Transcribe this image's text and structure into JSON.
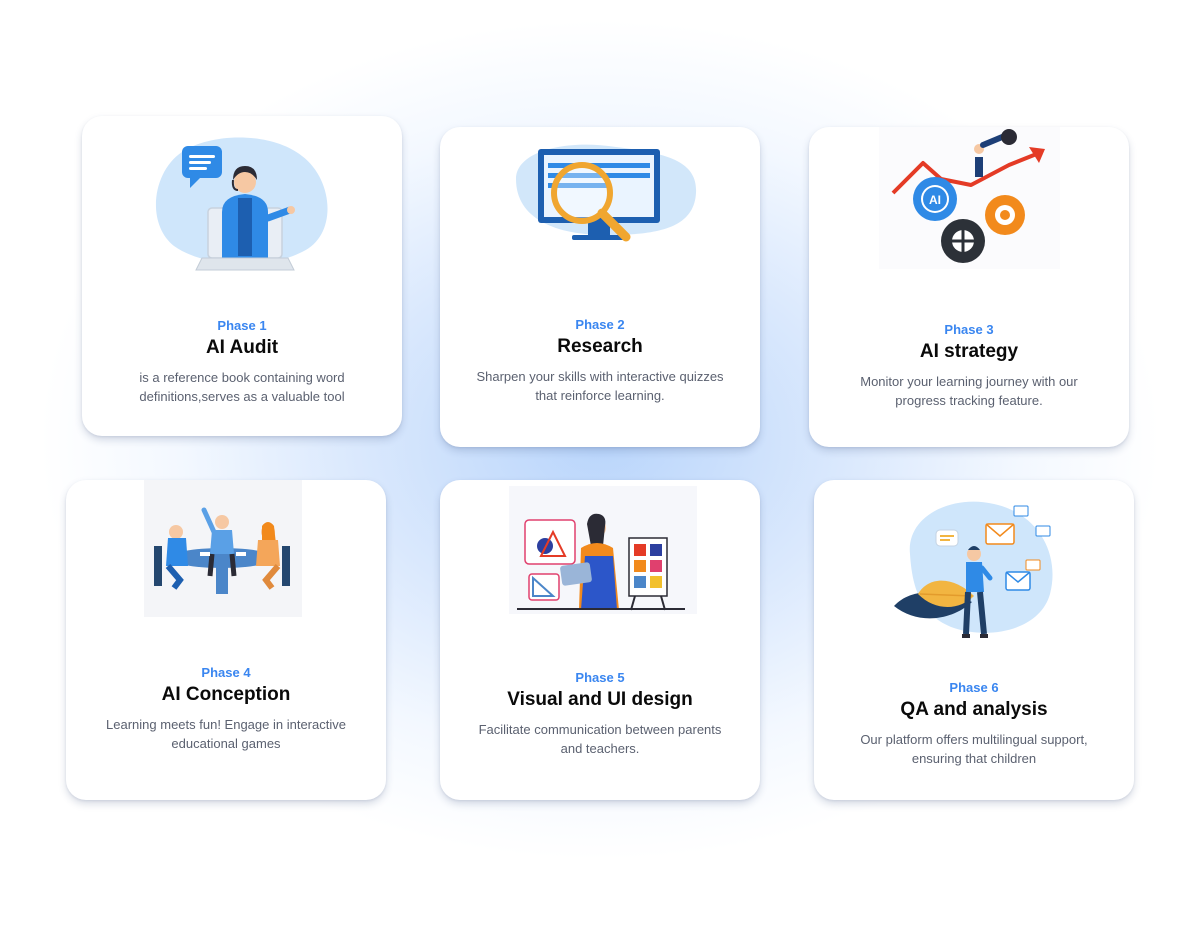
{
  "phases": [
    {
      "phase": "Phase 1",
      "title": "AI Audit",
      "description": "is a reference book containing word definitions,serves as a valuable tool",
      "illustration": "support-agent-laptop-illustration"
    },
    {
      "phase": "Phase 2",
      "title": "Research",
      "description": "Sharpen your skills with interactive quizzes that reinforce learning.",
      "illustration": "monitor-magnifier-illustration"
    },
    {
      "phase": "Phase 3",
      "title": "AI strategy",
      "description": "Monitor your learning journey with our progress tracking feature.",
      "illustration": "ai-gears-growth-illustration",
      "icon_text": "AI"
    },
    {
      "phase": "Phase 4",
      "title": "AI Conception",
      "description": "Learning meets fun! Engage in interactive educational games",
      "illustration": "team-at-table-illustration"
    },
    {
      "phase": "Phase 5",
      "title": "Visual and UI design",
      "description": "Facilitate communication between parents and teachers.",
      "illustration": "designer-with-tablet-illustration"
    },
    {
      "phase": "Phase 6",
      "title": "QA and analysis",
      "description": "Our platform offers multilingual support, ensuring that children",
      "illustration": "person-with-messages-illustration"
    }
  ],
  "colors": {
    "accent": "#3a86f0",
    "title": "#0a0a0a",
    "body_text": "#5b6170",
    "illustration_blue": "#2f8ae6",
    "illustration_orange": "#f28a1c"
  }
}
